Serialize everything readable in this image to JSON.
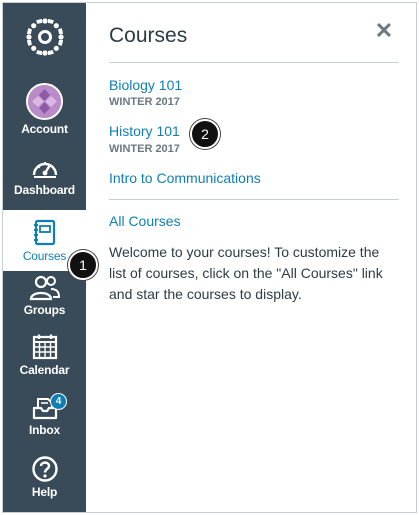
{
  "nav": {
    "account_label": "Account",
    "dashboard_label": "Dashboard",
    "courses_label": "Courses",
    "groups_label": "Groups",
    "calendar_label": "Calendar",
    "inbox_label": "Inbox",
    "inbox_badge": "4",
    "help_label": "Help"
  },
  "tray": {
    "title": "Courses",
    "courses": [
      {
        "name": "Biology 101",
        "term": "WINTER 2017"
      },
      {
        "name": "History 101",
        "term": "WINTER 2017"
      },
      {
        "name": "Intro to Communications",
        "term": ""
      }
    ],
    "all_courses_label": "All Courses",
    "welcome_text": "Welcome to your courses! To customize the list of courses, click on the \"All Courses\" link and star the courses to display."
  },
  "callouts": {
    "one": "1",
    "two": "2"
  },
  "colors": {
    "nav_bg": "#394b58",
    "link": "#0e7fb6",
    "active_text": "#0e7fb6"
  }
}
